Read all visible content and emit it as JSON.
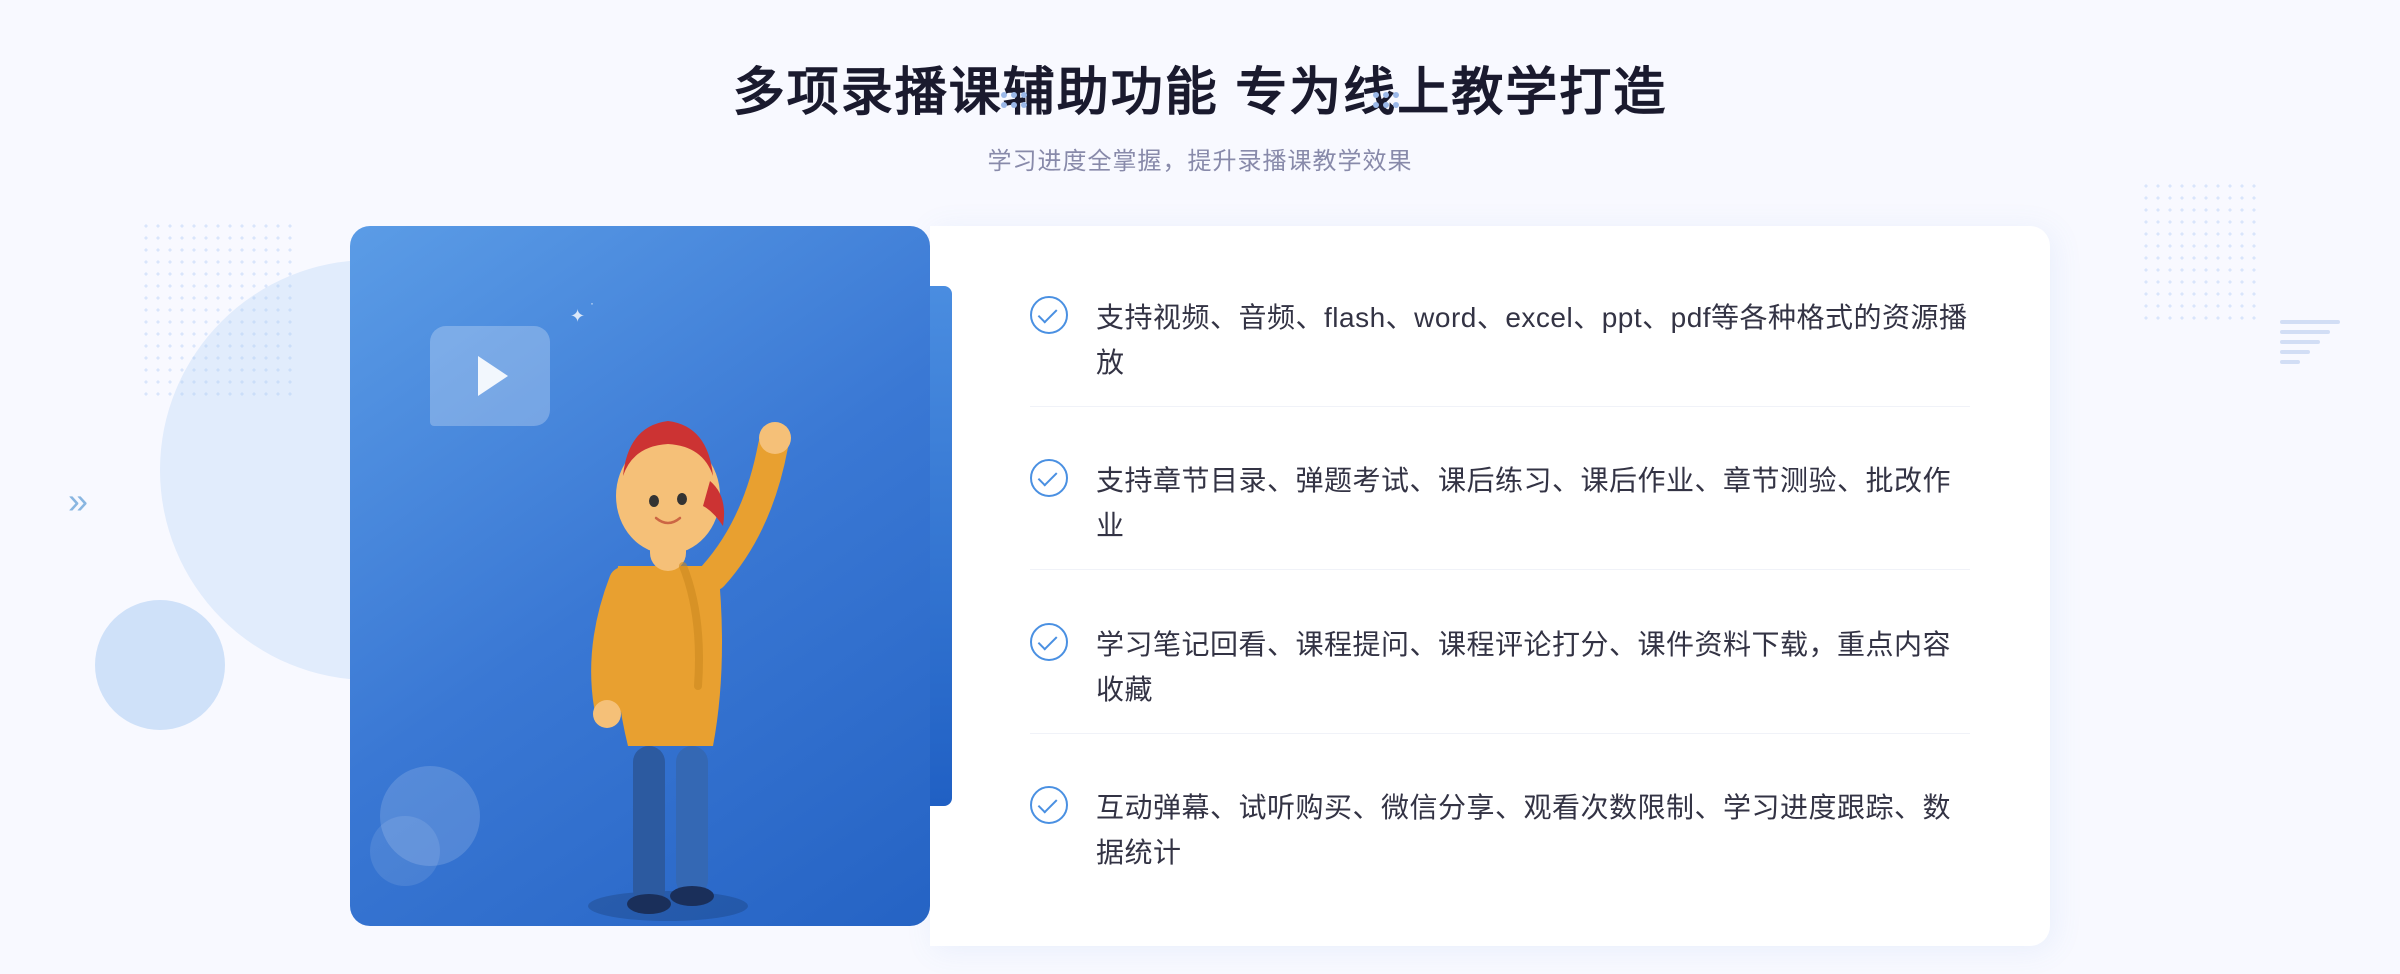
{
  "page": {
    "background_color": "#f8f9ff"
  },
  "header": {
    "dots_left": "decorative",
    "dots_right": "decorative",
    "main_title": "多项录播课辅助功能 专为线上教学打造",
    "sub_title": "学习进度全掌握，提升录播课教学效果"
  },
  "features": [
    {
      "id": 1,
      "text": "支持视频、音频、flash、word、excel、ppt、pdf等各种格式的资源播放"
    },
    {
      "id": 2,
      "text": "支持章节目录、弹题考试、课后练习、课后作业、章节测验、批改作业"
    },
    {
      "id": 3,
      "text": "学习笔记回看、课程提问、课程评论打分、课件资料下载，重点内容收藏"
    },
    {
      "id": 4,
      "text": "互动弹幕、试听购买、微信分享、观看次数限制、学习进度跟踪、数据统计"
    }
  ],
  "illustration": {
    "play_button": "▶",
    "accent_color": "#3a78d4"
  },
  "decorations": {
    "chevron": "»",
    "sparkle": "✦"
  }
}
